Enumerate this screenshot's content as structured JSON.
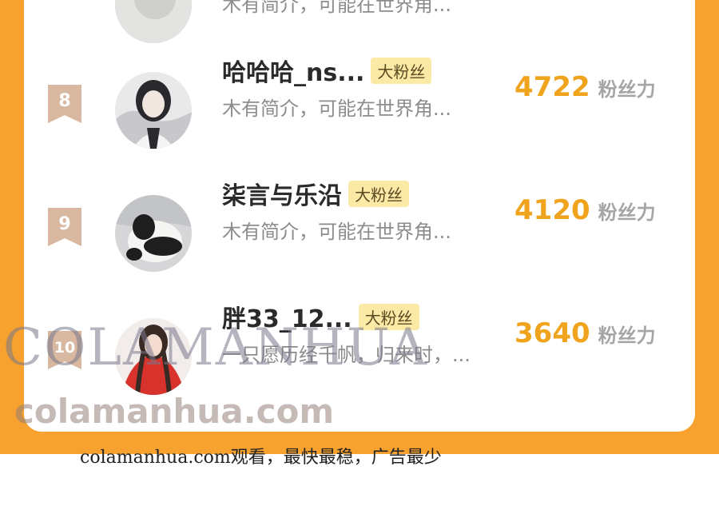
{
  "watermark": {
    "text": "COLAMANHUA",
    "site": "colamanhua.com"
  },
  "footer": {
    "text": "colamanhua.com观看，最快最稳，广告最少"
  },
  "top_partial": {
    "intro": "木有简介，可能在世界角..."
  },
  "rows": [
    {
      "rank": "8",
      "name": "哈哈哈_ns...",
      "badge": "大粉丝",
      "intro": "木有简介，可能在世界角...",
      "fans": "4722",
      "fans_label": "粉丝力"
    },
    {
      "rank": "9",
      "name": "柒言与乐沿",
      "badge": "大粉丝",
      "intro": "木有简介，可能在世界角...",
      "fans": "4120",
      "fans_label": "粉丝力"
    },
    {
      "rank": "10",
      "name": "胖33_12...",
      "badge": "大粉丝",
      "intro": "一只愿历经千帆，归来时，...",
      "fans": "3640",
      "fans_label": "粉丝力"
    }
  ],
  "colors": {
    "frame": "#f7a12e",
    "fans_number": "#f0a31c",
    "badge_bg": "#fbe9a6",
    "rank_tag": "#d8b8a0"
  }
}
